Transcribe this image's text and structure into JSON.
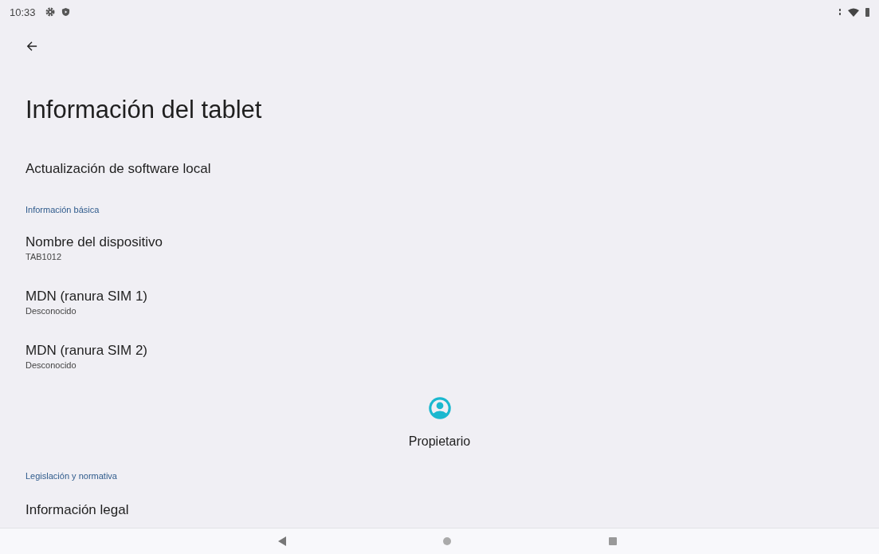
{
  "status_bar": {
    "time": "10:33"
  },
  "page": {
    "title": "Información del tablet"
  },
  "items": [
    {
      "kind": "item",
      "title": "Actualización de software local"
    },
    {
      "kind": "header",
      "title": "Información básica"
    },
    {
      "kind": "item",
      "title": "Nombre del dispositivo",
      "summary": "TAB1012"
    },
    {
      "kind": "item",
      "title": "MDN (ranura SIM 1)",
      "summary": "Desconocido"
    },
    {
      "kind": "item",
      "title": "MDN (ranura SIM 2)",
      "summary": "Desconocido"
    },
    {
      "kind": "owner",
      "title": "Propietario"
    },
    {
      "kind": "header",
      "title": "Legislación y normativa"
    },
    {
      "kind": "item",
      "title": "Información legal"
    }
  ]
}
